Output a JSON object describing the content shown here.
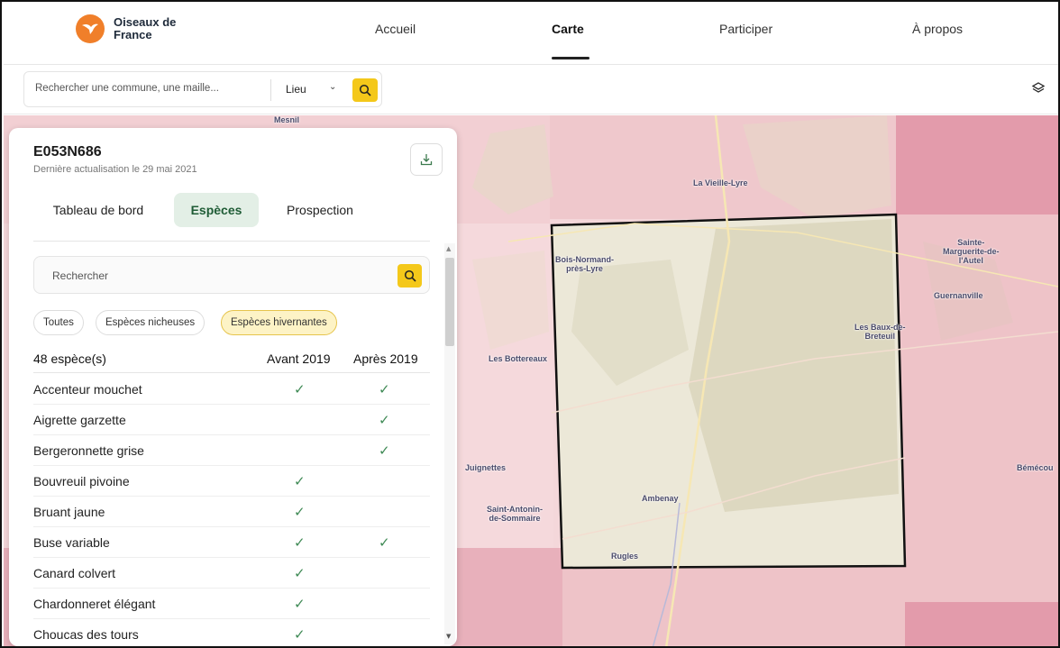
{
  "header": {
    "brand": "Oiseaux de France",
    "nav": [
      "Accueil",
      "Carte",
      "Participer",
      "À propos"
    ],
    "active_nav": "Carte"
  },
  "search": {
    "placeholder": "Rechercher une commune, une maille...",
    "type_value": "Lieu"
  },
  "map": {
    "labels": {
      "mesnil": "Mesnil",
      "vieille_lyre": "La Vieille-Lyre",
      "bois_normand": "Bois-Normand-\nprès-Lyre",
      "sainte_marguerite": "Sainte-\nMarguerite-de-\nl'Autel",
      "guernanville": "Guernanville",
      "baux": "Les Baux-de-\nBreteuil",
      "bottereaux": "Les Bottereaux",
      "juignettes": "Juignettes",
      "bemecourt": "Bémécou",
      "saint_antonin": "Saint-Antonin-\nde-Sommaire",
      "ambenay": "Ambenay",
      "rugles": "Rugles"
    },
    "colors": {
      "light_pink": "#f4d7da",
      "pink": "#eec3c8",
      "dark_pink": "#e39bab",
      "selected": "#ece8d8",
      "outline": "#111111"
    }
  },
  "panel": {
    "cell_id": "E053N686",
    "updated": "Dernière actualisation le 29 mai 2021",
    "tabs": [
      "Tableau de bord",
      "Espèces",
      "Prospection"
    ],
    "active_tab": "Espèces",
    "search_placeholder": "Rechercher",
    "filters": [
      "Toutes",
      "Espèces nicheuses",
      "Espèces hivernantes"
    ],
    "active_filter": "Espèces hivernantes",
    "count_label": "48 espèce(s)",
    "col_before": "Avant 2019",
    "col_after": "Après 2019",
    "species": [
      {
        "name": "Accenteur mouchet",
        "before": true,
        "after": true
      },
      {
        "name": "Aigrette garzette",
        "before": false,
        "after": true
      },
      {
        "name": "Bergeronnette grise",
        "before": false,
        "after": true
      },
      {
        "name": "Bouvreuil pivoine",
        "before": true,
        "after": false
      },
      {
        "name": "Bruant jaune",
        "before": true,
        "after": false
      },
      {
        "name": "Buse variable",
        "before": true,
        "after": true
      },
      {
        "name": "Canard colvert",
        "before": true,
        "after": false
      },
      {
        "name": "Chardonneret élégant",
        "before": true,
        "after": false
      },
      {
        "name": "Choucas des tours",
        "before": true,
        "after": false
      }
    ]
  }
}
